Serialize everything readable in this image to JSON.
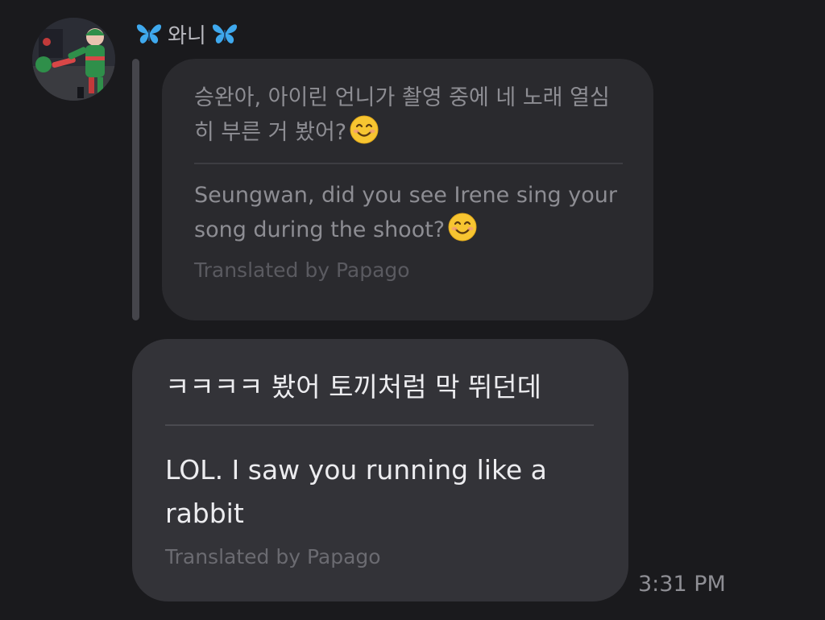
{
  "sender": {
    "name": "와니",
    "left_icon": "butterfly-icon",
    "right_icon": "butterfly-icon"
  },
  "avatar": {
    "description_icon": "profile-avatar"
  },
  "quoted_message": {
    "original_text": "승완아, 아이린 언니가 촬영 중에 네 노래 열심히 부른 거 봤어?",
    "translated_text": "Seungwan, did you see Irene sing your song during the shoot?",
    "emoji": "smiling-face-icon",
    "translation_credit": "Translated by Papago"
  },
  "message": {
    "original_text": "ㅋㅋㅋㅋ 봤어 토끼처럼 막 뛰던데",
    "translated_text": "LOL. I saw you running like a rabbit",
    "translation_credit": "Translated by Papago"
  },
  "timestamp": "3:31 PM",
  "colors": {
    "background": "#1a1a1d",
    "quote_bubble": "#2a2a2e",
    "main_bubble": "#333338",
    "butterfly": "#3fa9ee"
  }
}
